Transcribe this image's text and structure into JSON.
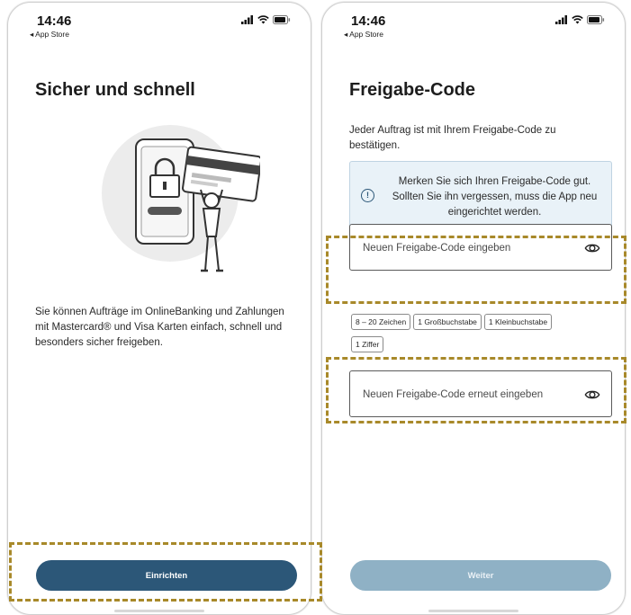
{
  "screens": {
    "left": {
      "status": {
        "time": "14:46",
        "back_label": "◂ App Store"
      },
      "title": "Sicher und schnell",
      "body": "Sie können Aufträge im OnlineBanking und Zahlungen mit Mastercard® und Visa Karten einfach, schnell und besonders sicher freigeben.",
      "button_label": "Einrichten"
    },
    "right": {
      "status": {
        "time": "14:46",
        "back_label": "◂ App Store"
      },
      "title": "Freigabe-Code",
      "intro": "Jeder Auftrag ist mit Ihrem Freigabe-Code zu bestätigen.",
      "info": "Merken Sie sich Ihren Freigabe-Code gut. Sollten Sie ihn vergessen, muss die App neu eingerichtet werden.",
      "input_new_placeholder": "Neuen Freigabe-Code eingeben",
      "input_repeat_placeholder": "Neuen Freigabe-Code erneut eingeben",
      "rules": [
        "8 – 20 Zeichen",
        "1 Großbuchstabe",
        "1 Kleinbuchstabe",
        "1 Ziffer"
      ],
      "button_label": "Weiter"
    }
  },
  "icons": {
    "info": "info-circle-icon",
    "password_visibility": "eye-icon",
    "signal": "signal-icon",
    "wifi": "wifi-icon",
    "battery": "battery-icon",
    "illustration": "phone-lock-card-illustration"
  },
  "colors": {
    "primary": "#2c5778",
    "primary_disabled": "#8fb1c5",
    "info_background": "#e9f2f8",
    "highlight_dash": "#a8892a"
  }
}
